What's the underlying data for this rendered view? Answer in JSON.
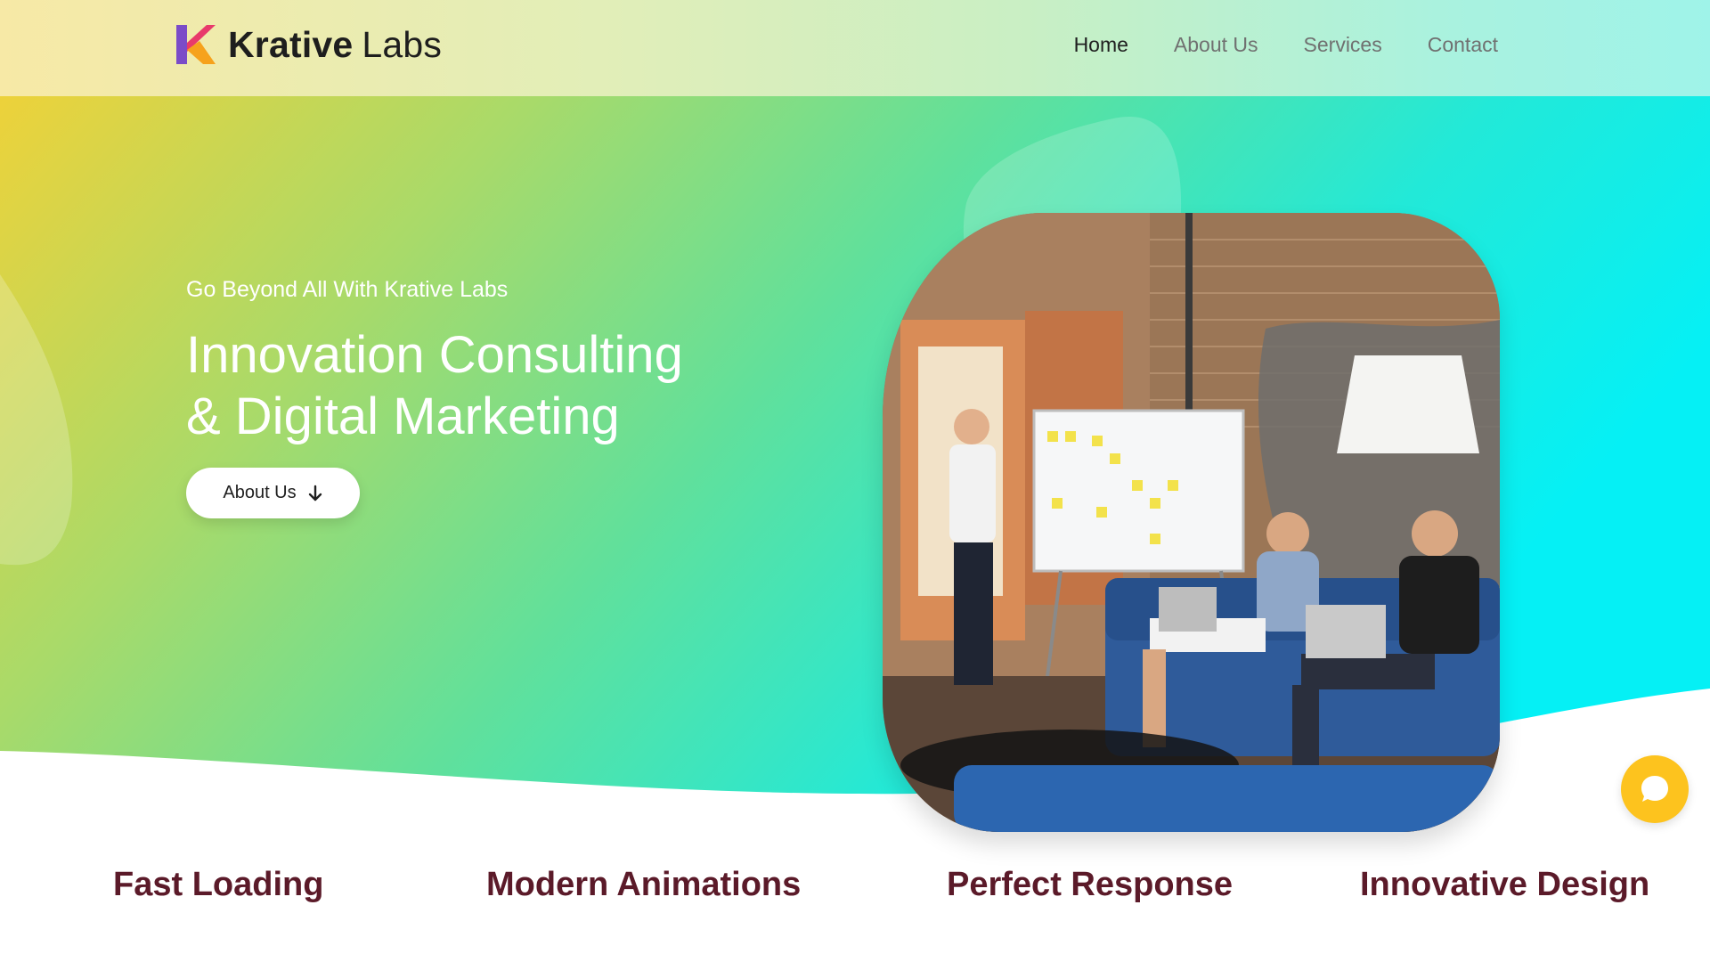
{
  "brand": {
    "name_strong": "Krative",
    "name_light": "Labs",
    "colors": {
      "mark_orange": "#f6a21c",
      "mark_pink": "#e83a6b",
      "mark_purple": "#7b4cc8"
    }
  },
  "nav": {
    "items": [
      {
        "label": "Home",
        "active": true
      },
      {
        "label": "About Us",
        "active": false
      },
      {
        "label": "Services",
        "active": false
      },
      {
        "label": "Contact",
        "active": false
      }
    ]
  },
  "hero": {
    "subtitle": "Go Beyond All With Krative Labs",
    "title_line1": "Innovation Consulting",
    "title_line2": "& Digital Marketing",
    "button_label": "About Us",
    "button_icon": "arrow-down-icon",
    "gradient": [
      "#edd23a",
      "#a8da6a",
      "#62e09a",
      "#22e9d8",
      "#05f0f5"
    ]
  },
  "features": [
    "Fast Loading",
    "Modern Animations",
    "Perfect Response",
    "Innovative Design"
  ],
  "chat": {
    "icon": "chat-bubble-icon",
    "color": "#fdc31e"
  }
}
